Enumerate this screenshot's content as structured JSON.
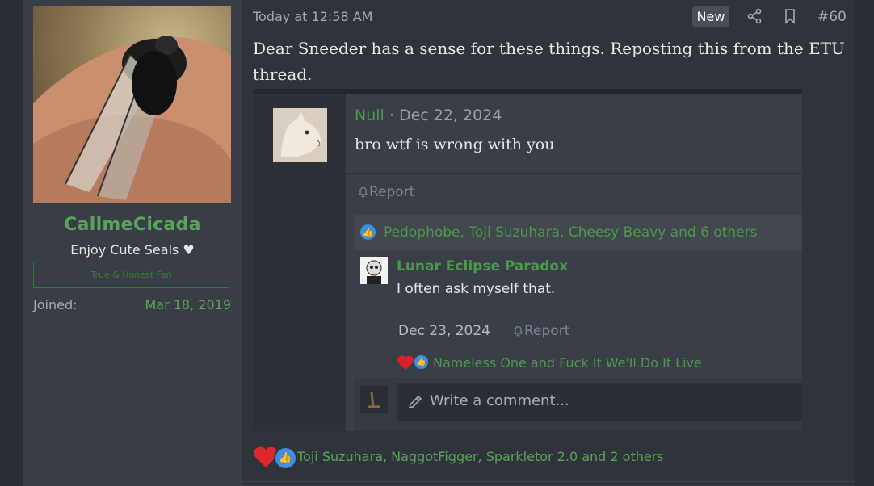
{
  "user": {
    "avatar_icon": "cicada-avatar",
    "username": "CallmeCicada",
    "title": "Enjoy Cute Seals ♥",
    "banner": "True & Honest Fan",
    "joined_label": "Joined:",
    "joined_value": "Mar 18, 2019"
  },
  "post": {
    "timestamp": "Today at 12:58 AM",
    "new_badge": "New",
    "share_icon": "share-icon",
    "bookmark_icon": "bookmark-icon",
    "number": "#60",
    "text": "Dear Sneeder has a sense for these things. Reposting this from the ETU thread."
  },
  "embed": {
    "author": "Null",
    "separator": " · ",
    "date": "Dec 22, 2024",
    "message": "bro wtf is wrong with you",
    "report_label": "Report",
    "reactions_names": "Pedophobe, Toji Suzuhara, Cheesy Beavy and 6 others",
    "reply": {
      "author": "Lunar Eclipse Paradox",
      "text": "I often ask myself that.",
      "date": "Dec 23, 2024",
      "report_label": "Report",
      "reactions_names": "Nameless One and Fuck It We'll Do It Live"
    },
    "comment_placeholder": "Write a comment..."
  },
  "reactions": {
    "names": "Toji Suzuhara, NaggotFigger, Sparkletor 2.0 and 2 others"
  },
  "colors": {
    "accent_green": "#5aa35a",
    "background": "#2b2f35",
    "like_blue": "#3d8de0",
    "love_red": "#e0272e"
  }
}
